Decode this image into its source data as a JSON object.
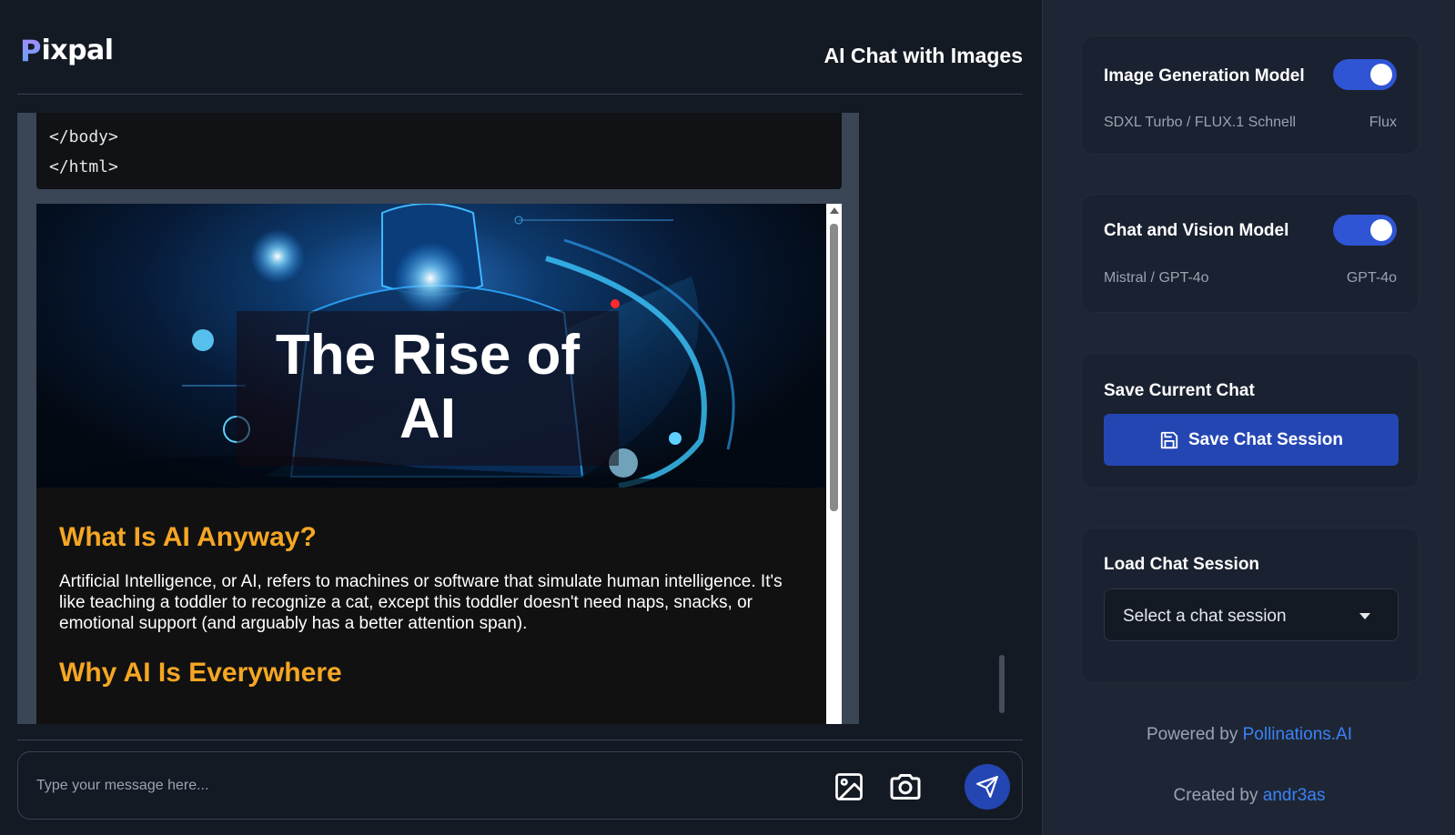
{
  "app": {
    "logo_initial": "P",
    "logo_rest": "ixpal",
    "title": "AI Chat with Images"
  },
  "chat": {
    "code_lines": [
      "</body>",
      "</html>"
    ],
    "document": {
      "hero_title_line1": "The Rise of",
      "hero_title_line2": "AI",
      "section1_heading": "What Is AI Anyway?",
      "section1_text": "Artificial Intelligence, or AI, refers to machines or software that simulate human intelligence. It's like teaching a toddler to recognize a cat, except this toddler doesn't need naps, snacks, or emotional support (and arguably has a better attention span).",
      "section2_heading": "Why AI Is Everywhere"
    }
  },
  "composer": {
    "placeholder": "Type your message here...",
    "icons": [
      "image-upload-icon",
      "camera-icon",
      "send-icon"
    ]
  },
  "sidebar": {
    "image_model": {
      "title": "Image Generation Model",
      "options": "SDXL Turbo / FLUX.1 Schnell",
      "selected": "Flux",
      "toggle_on": true
    },
    "chat_model": {
      "title": "Chat and Vision Model",
      "options": "Mistral / GPT-4o",
      "selected": "GPT-4o",
      "toggle_on": true
    },
    "save": {
      "title": "Save Current Chat",
      "button_label": "Save Chat Session"
    },
    "load": {
      "title": "Load Chat Session",
      "select_value": "Select a chat session"
    },
    "footer": {
      "powered_prefix": "Powered by ",
      "powered_link": "Pollinations.AI",
      "created_prefix": "Created by ",
      "created_link": "andr3as"
    }
  },
  "colors": {
    "accent": "#2446b3",
    "toggle": "#2f55d4",
    "heading_orange": "#f5a623",
    "link": "#3b82f6"
  }
}
